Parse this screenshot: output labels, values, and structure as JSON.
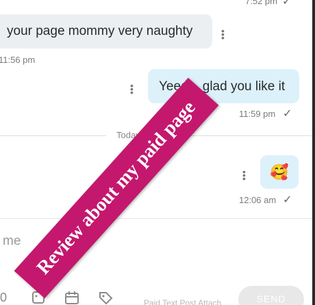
{
  "chat": {
    "top_time": "7:52 pm",
    "messages": [
      {
        "text": "your page mommy very naughty",
        "time": "11:56 pm"
      },
      {
        "text": "Yeeah, glad you like it",
        "time": "11:59 pm"
      },
      {
        "text": "🥰",
        "time": "12:06 am"
      }
    ],
    "day_label": "Today"
  },
  "composer": {
    "placeholder": "me",
    "send_label": "SEND",
    "faint_text": "Paid  Text  Post  Attach"
  },
  "overlay": {
    "banner_text": "Review about my paid page",
    "banner_color": "#c3186e"
  },
  "icons": [
    "check-icon",
    "more-vert-icon",
    "mic-icon",
    "image-icon",
    "calendar-icon",
    "price-tag-icon"
  ]
}
